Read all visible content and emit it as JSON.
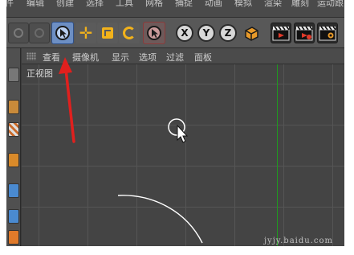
{
  "menubar": {
    "items": [
      "件",
      "编辑",
      "创建",
      "选择",
      "工具",
      "网格",
      "捕捉",
      "动画",
      "模拟",
      "渲染",
      "雕刻",
      "运动跟"
    ]
  },
  "toolbar": {
    "axis_x": "X",
    "axis_y": "Y",
    "axis_z": "Z"
  },
  "viewport_menu": {
    "items": [
      "查看",
      "摄像机",
      "显示",
      "选项",
      "过滤",
      "面板"
    ]
  },
  "viewport": {
    "label": "正视图",
    "watermark": "jyjy.baidu.com"
  },
  "colors": {
    "accent_selected": "#5b86c8",
    "annotation_arrow": "#e0201e",
    "y_axis": "#1f9a1f"
  }
}
